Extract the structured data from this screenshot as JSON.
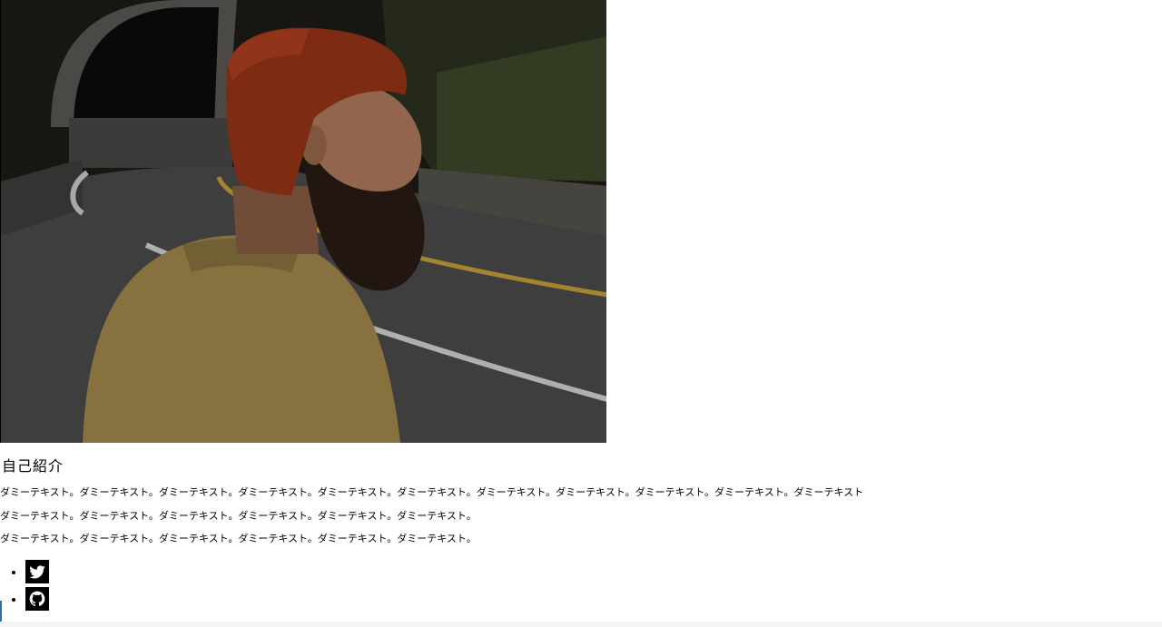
{
  "hero": {
    "image_alt": "bearded-man-red-beanie-on-road"
  },
  "profile": {
    "heading": "自己紹介",
    "paragraphs": [
      "ダミーテキスト。ダミーテキスト。ダミーテキスト。ダミーテキスト。ダミーテキスト。ダミーテキスト。ダミーテキスト。ダミーテキスト。ダミーテキスト。ダミーテキスト。ダミーテキスト",
      "ダミーテキスト。ダミーテキスト。ダミーテキスト。ダミーテキスト。ダミーテキスト。ダミーテキスト。",
      "ダミーテキスト。ダミーテキスト。ダミーテキスト。ダミーテキスト。ダミーテキスト。ダミーテキスト。"
    ]
  },
  "social": {
    "items": [
      {
        "icon": "twitter-icon"
      },
      {
        "icon": "github-icon"
      }
    ]
  },
  "colors": {
    "page_bg": "#ffffff",
    "icon_bg": "#000000",
    "icon_fg": "#ffffff"
  }
}
